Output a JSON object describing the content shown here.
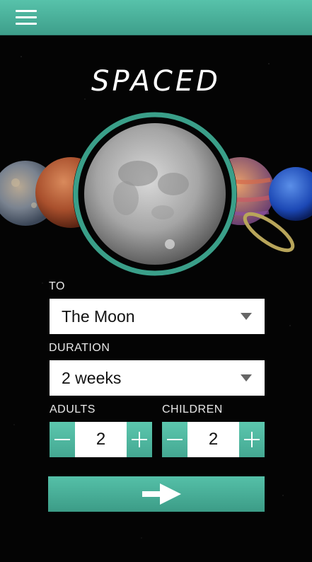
{
  "header": {
    "menu_icon": "hamburger-menu-icon"
  },
  "brand": {
    "logo_text": "SPACED"
  },
  "destination": {
    "label": "TO",
    "selected": "The Moon"
  },
  "duration": {
    "label": "DURATION",
    "selected": "2 weeks"
  },
  "adults": {
    "label": "ADULTS",
    "value": "2"
  },
  "children": {
    "label": "CHILDREN",
    "value": "2"
  },
  "submit": {
    "icon": "arrow-right-icon"
  },
  "colors": {
    "accent": "#4bb59e",
    "accent_dark": "#2e8c78",
    "background": "#040404",
    "field": "#ffffff"
  }
}
